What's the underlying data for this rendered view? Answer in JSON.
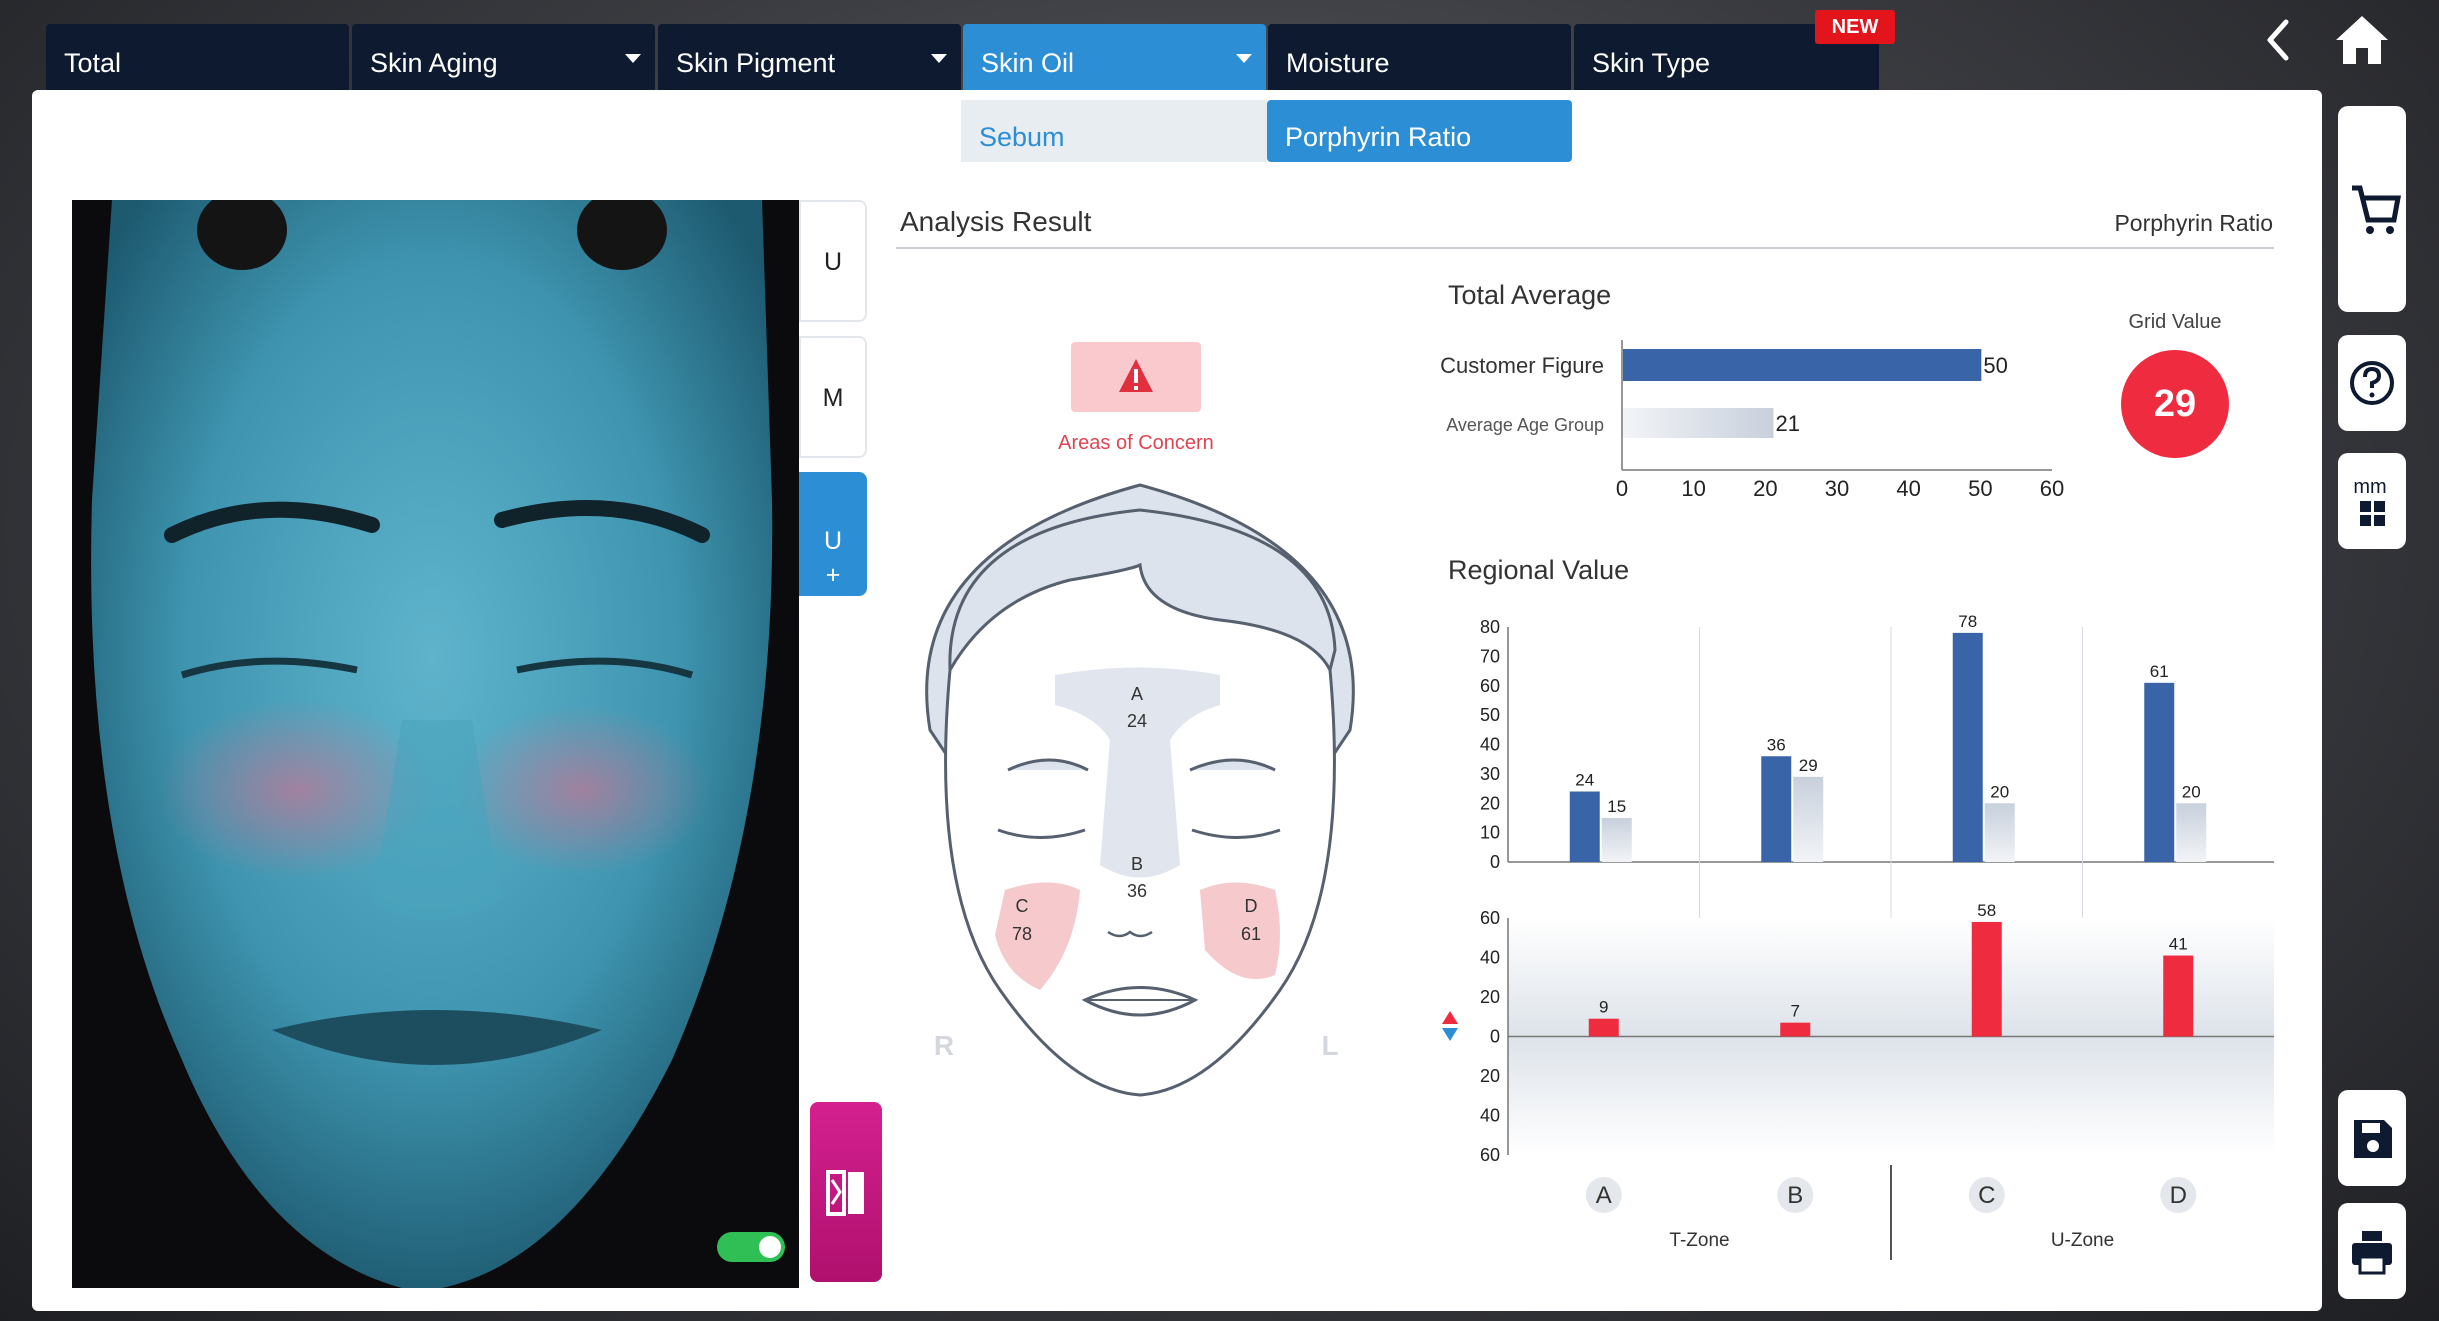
{
  "tabs": [
    {
      "label": "Total",
      "has_dropdown": false
    },
    {
      "label": "Skin Aging",
      "has_dropdown": true
    },
    {
      "label": "Skin Pigment",
      "has_dropdown": true
    },
    {
      "label": "Skin Oil",
      "has_dropdown": true,
      "active": true
    },
    {
      "label": "Moisture",
      "has_dropdown": false
    },
    {
      "label": "Skin Type",
      "has_dropdown": false,
      "badge": "NEW"
    }
  ],
  "subtabs": [
    {
      "label": "Sebum"
    },
    {
      "label": "Porphyrin Ratio",
      "active": true
    }
  ],
  "modes": [
    {
      "label": "U"
    },
    {
      "label": "M"
    },
    {
      "label": "U\n+\nM",
      "active": true
    }
  ],
  "analysis": {
    "title": "Analysis Result",
    "metric": "Porphyrin Ratio",
    "concern_label": "Areas of Concern",
    "side_right": "R",
    "side_left": "L",
    "regions": [
      {
        "id": "A",
        "value": "24"
      },
      {
        "id": "B",
        "value": "36"
      },
      {
        "id": "C",
        "value": "78"
      },
      {
        "id": "D",
        "value": "61"
      }
    ]
  },
  "total_average": {
    "title": "Total Average",
    "customer_label": "Customer Figure",
    "age_label": "Average Age Group",
    "grid_label": "Grid Value",
    "grid_value": "29"
  },
  "regional": {
    "title": "Regional Value",
    "zone_t": "T-Zone",
    "zone_u": "U-Zone"
  },
  "colors": {
    "accent": "#2c8ed4",
    "customer_bar": "#3a64a8",
    "concern": "#ef2b40",
    "tab_bg": "#0e1a30"
  },
  "icons": [
    "back-icon",
    "home-icon",
    "cart-icon",
    "help-icon",
    "grid-mm-icon",
    "save-icon",
    "print-icon",
    "compare-icon",
    "warning-icon"
  ],
  "chart_data": [
    {
      "type": "bar",
      "orientation": "horizontal",
      "categories": [
        "Customer Figure",
        "Average Age Group"
      ],
      "values": [
        50,
        21
      ],
      "xlim": [
        0,
        60
      ],
      "xticks": [
        0,
        10,
        20,
        30,
        40,
        50,
        60
      ]
    },
    {
      "type": "bar",
      "categories": [
        "A",
        "B",
        "C",
        "D"
      ],
      "series": [
        {
          "values": [
            24,
            36,
            78,
            61
          ]
        },
        {
          "values": [
            15,
            29,
            20,
            20
          ]
        }
      ],
      "ylim": [
        0,
        80
      ],
      "yticks": [
        0,
        10,
        20,
        30,
        40,
        50,
        60,
        70,
        80
      ]
    },
    {
      "type": "bar",
      "categories": [
        "A",
        "B",
        "C",
        "D"
      ],
      "values": [
        9,
        7,
        58,
        41
      ],
      "ylim": [
        -60,
        60
      ],
      "yticks": [
        60,
        40,
        20,
        0,
        20,
        40,
        60
      ]
    }
  ]
}
